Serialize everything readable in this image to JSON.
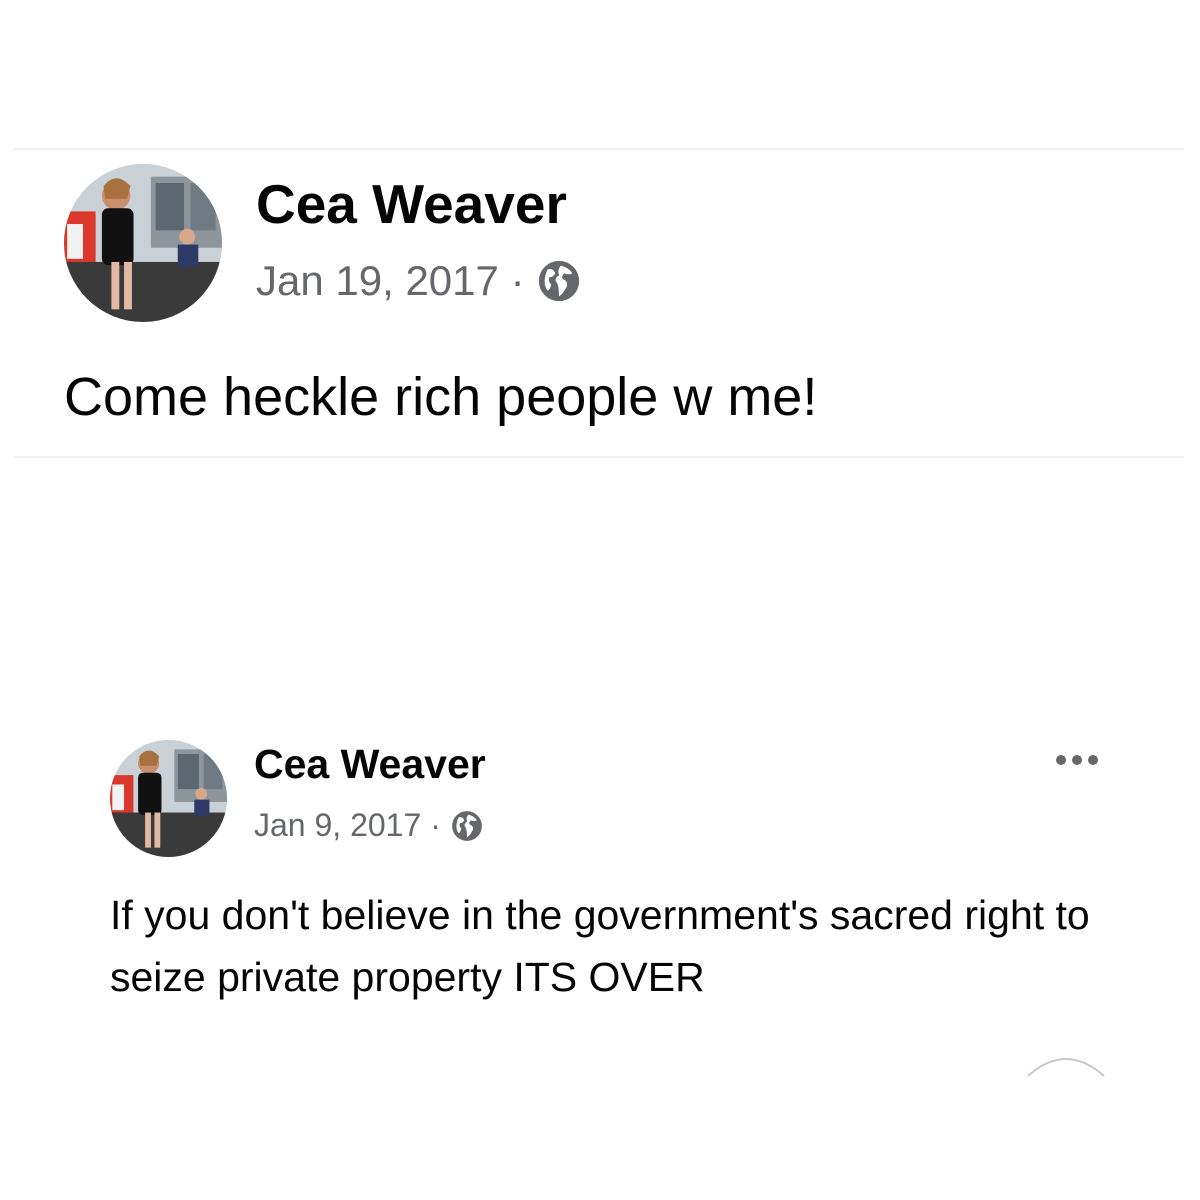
{
  "posts": [
    {
      "author": "Cea Weaver",
      "date": "Jan 19, 2017",
      "separator": "·",
      "privacy_icon": "globe-icon",
      "text": "Come heckle rich people w me!"
    },
    {
      "author": "Cea Weaver",
      "date": "Jan 9, 2017",
      "separator": "·",
      "privacy_icon": "globe-icon",
      "more_icon": "more-options-icon",
      "text": "If you don't believe in the government's sacred right to seize private property ITS OVER"
    }
  ],
  "colors": {
    "text": "#050505",
    "secondary": "#65676b",
    "divider": "#f0f0f0"
  }
}
